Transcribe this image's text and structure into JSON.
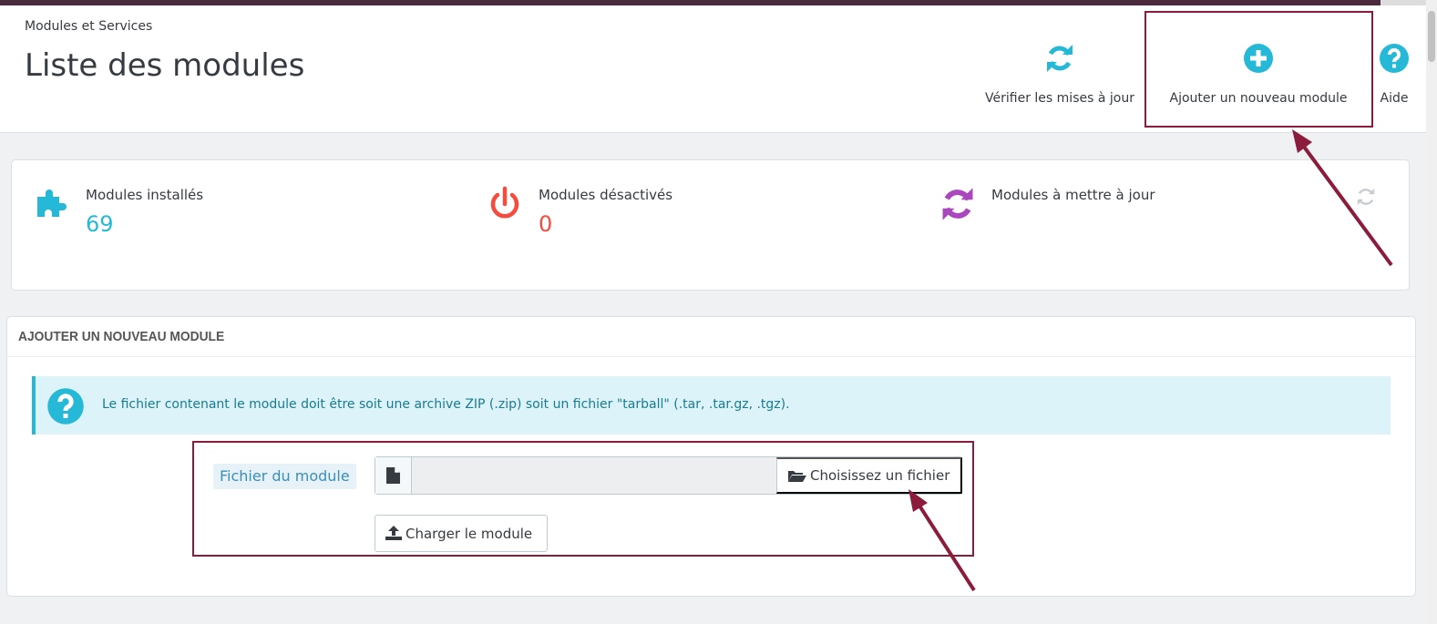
{
  "header": {
    "breadcrumb": "Modules et Services",
    "title": "Liste des modules"
  },
  "toolbar": {
    "check_updates_label": "Vérifier les mises à jour",
    "add_module_label": "Ajouter un nouveau module",
    "help_label": "Aide"
  },
  "stats": {
    "installed": {
      "label": "Modules installés",
      "value": "69"
    },
    "disabled": {
      "label": "Modules désactivés",
      "value": "0"
    },
    "to_update": {
      "label": "Modules à mettre à jour"
    }
  },
  "upload_panel": {
    "heading": "AJOUTER UN NOUVEAU MODULE",
    "info": "Le fichier contenant le module doit être soit une archive ZIP (.zip) soit un fichier \"tarball\" (.tar, .tar.gz, .tgz).",
    "field_label": "Fichier du module",
    "file_value": "",
    "choose_file_label": "Choisissez un fichier",
    "upload_label": "Charger le module"
  },
  "colors": {
    "accent": "#25b9d7",
    "installed": "#25b9d7",
    "disabled": "#f54c3e",
    "update": "#ab47bc",
    "highlight": "#8b1c3c"
  },
  "icons": {
    "check_updates": "refresh-icon",
    "add_module": "plus-circle-icon",
    "help": "question-circle-icon",
    "installed": "puzzle-icon",
    "disabled": "power-icon",
    "to_update": "refresh-icon",
    "file": "file-icon",
    "choose_file": "folder-open-icon",
    "upload": "upload-icon"
  }
}
